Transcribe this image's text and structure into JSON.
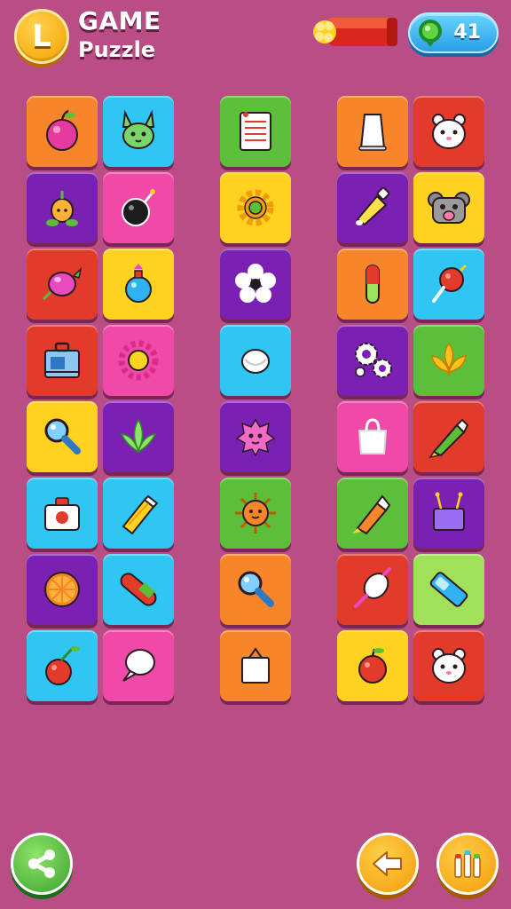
{
  "header": {
    "logo_letter": "L",
    "title": "GAME",
    "subtitle": "Puzzle",
    "counter_value": "41",
    "booster_icon": "firework-rocket-icon",
    "gem_icon": "green-gem-icon"
  },
  "board": {
    "tiles": [
      {
        "icon": "plum-icon",
        "color": "#f7862b"
      },
      {
        "icon": "bunny-face-icon",
        "color": "#2fc6f4"
      },
      {
        "icon": "notepad-icon",
        "color": "#5cbf3a"
      },
      {
        "icon": "paper-cup-icon",
        "color": "#f7862b"
      },
      {
        "icon": "hamster-face-icon",
        "color": "#e23b2c"
      },
      {
        "icon": "onion-sprout-icon",
        "color": "#7a21b3"
      },
      {
        "icon": "black-bomb-icon",
        "color": "#ef4aa8"
      },
      {
        "icon": "gear-icon",
        "color": "#ffd21f"
      },
      {
        "icon": "paint-tube-icon",
        "color": "#7a21b3"
      },
      {
        "icon": "koala-camera-icon",
        "color": "#ffd21f"
      },
      {
        "icon": "candy-icon",
        "color": "#e23b2c"
      },
      {
        "icon": "blue-potion-icon",
        "color": "#ffd21f"
      },
      {
        "icon": "flower-icon",
        "color": "#7a21b3"
      },
      {
        "icon": "capsule-pill-icon",
        "color": "#f7862b"
      },
      {
        "icon": "red-pin-icon",
        "color": "#2fc6f4"
      },
      {
        "icon": "toolbox-icon",
        "color": "#e23b2c"
      },
      {
        "icon": "sun-gear-icon",
        "color": "#ef4aa8"
      },
      {
        "icon": "egg-icon",
        "color": "#2fc6f4"
      },
      {
        "icon": "gears-icon",
        "color": "#7a21b3"
      },
      {
        "icon": "leaf-icon",
        "color": "#5cbf3a"
      },
      {
        "icon": "magnifier-icon",
        "color": "#ffd21f"
      },
      {
        "icon": "plant-leaves-icon",
        "color": "#7a21b3"
      },
      {
        "icon": "pink-blob-icon",
        "color": "#7a21b3"
      },
      {
        "icon": "white-bag-icon",
        "color": "#ef4aa8"
      },
      {
        "icon": "green-crayon-icon",
        "color": "#e23b2c"
      },
      {
        "icon": "first-aid-kit-icon",
        "color": "#2fc6f4"
      },
      {
        "icon": "yellow-crayon-icon",
        "color": "#2fc6f4"
      },
      {
        "icon": "sun-face-icon",
        "color": "#5cbf3a"
      },
      {
        "icon": "rocket-crayon-icon",
        "color": "#5cbf3a"
      },
      {
        "icon": "purple-box-icon",
        "color": "#7a21b3"
      },
      {
        "icon": "orange-slice-icon",
        "color": "#7a21b3"
      },
      {
        "icon": "pill-icon",
        "color": "#2fc6f4"
      },
      {
        "icon": "magnifier-icon",
        "color": "#f7862b"
      },
      {
        "icon": "white-brush-icon",
        "color": "#e23b2c"
      },
      {
        "icon": "blue-battery-icon",
        "color": "#a3e05a"
      },
      {
        "icon": "cherry-icon",
        "color": "#2fc6f4"
      },
      {
        "icon": "speech-balloon-icon",
        "color": "#ef4aa8"
      },
      {
        "icon": "shopping-bag-icon",
        "color": "#f7862b"
      },
      {
        "icon": "apple-icon",
        "color": "#ffd21f"
      },
      {
        "icon": "hamster-face-icon",
        "color": "#e23b2c"
      }
    ]
  },
  "footer": {
    "share_icon": "share-icon",
    "back_icon": "back-arrow-icon",
    "tools_icon": "crayons-icon"
  }
}
